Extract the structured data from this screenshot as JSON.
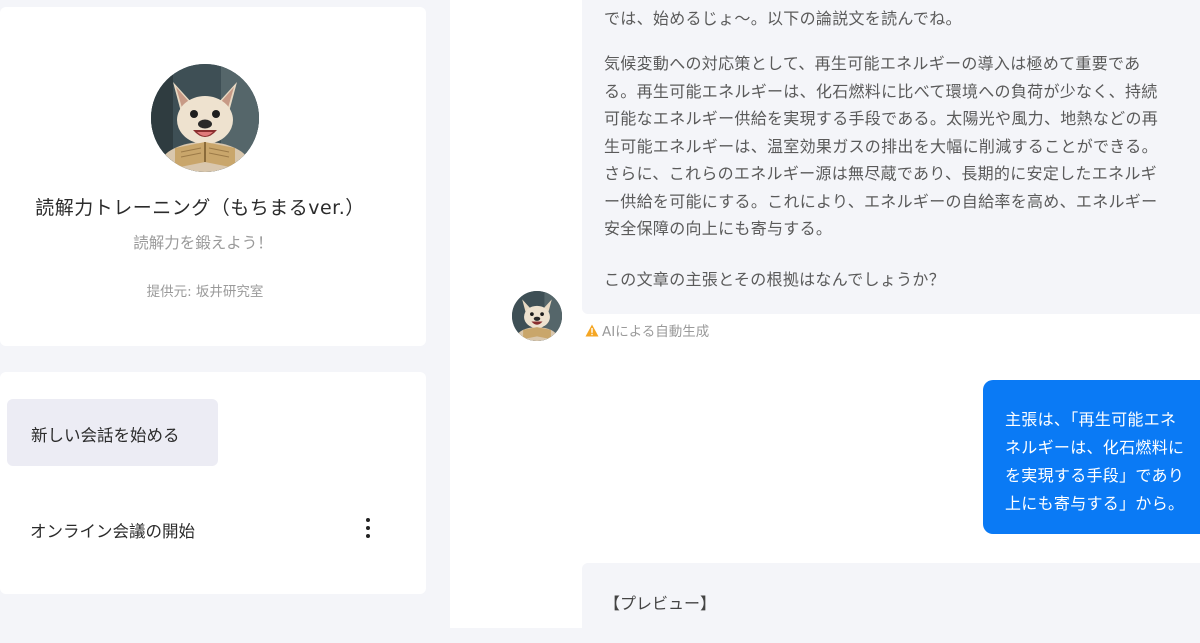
{
  "profile": {
    "name": "読解力トレーニング（もちまるver.）",
    "description": "読解力を鍛えよう！",
    "provider": "提供元: 坂井研究室",
    "avatar_icon": "french-bulldog-reading-book"
  },
  "sidebar": {
    "new_chat_label": "新しい会話を始める",
    "history": [
      {
        "label": "オンライン会議の開始",
        "menu_icon": "kebab-menu-icon"
      }
    ]
  },
  "chat": {
    "bot_message": {
      "intro": "では、始めるじょ〜。以下の論説文を読んでね。",
      "passage_lines": [
        "気候変動への対応策として、再生可能エネルギーの導入は極めて重要であ",
        "る。再生可能エネルギーは、化石燃料に比べて環境への負荷が少なく、持続",
        "可能なエネルギー供給を実現する手段である。太陽光や風力、地熱などの再",
        "生可能エネルギーは、温室効果ガスの排出を大幅に削減することができる。",
        "さらに、これらのエネルギー源は無尽蔵であり、長期的に安定したエネルギ",
        "ー供給を可能にする。これにより、エネルギーの自給率を高め、エネルギー",
        "安全保障の向上にも寄与する。"
      ],
      "question": "この文章の主張とその根拠はなんでしょうか？"
    },
    "ai_notice": "AIによる自動生成",
    "user_message_lines": [
      "主張は、「再生可能エネ",
      "ネルギーは、化石燃料に",
      "を実現する手段」であり",
      "上にも寄与する」から。"
    ],
    "preview_label": "【プレビュー】"
  },
  "colors": {
    "background": "#f4f5f9",
    "user_bubble": "#0a7af5",
    "new_chat_button": "#ececf4",
    "warning": "#f5a623"
  }
}
